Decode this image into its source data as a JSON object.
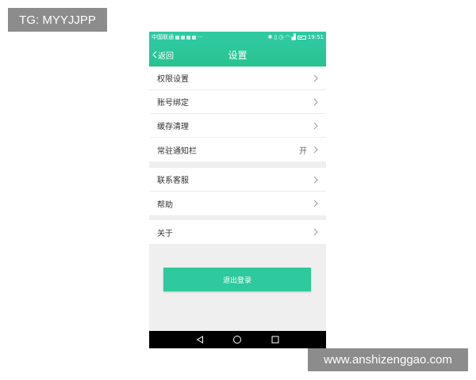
{
  "watermark_top": "TG: MYYJJPP",
  "watermark_bottom": "www.anshizenggao.com",
  "statusbar": {
    "carrier": "中国联通",
    "dots": "···",
    "time": "19:51"
  },
  "header": {
    "back_label": "返回",
    "title": "设置"
  },
  "groups": [
    {
      "items": [
        {
          "label": "权限设置"
        },
        {
          "label": "账号绑定"
        },
        {
          "label": "缓存清理"
        },
        {
          "label": "常驻通知栏",
          "value": "开"
        }
      ]
    },
    {
      "items": [
        {
          "label": "联系客服"
        },
        {
          "label": "帮助"
        }
      ]
    },
    {
      "items": [
        {
          "label": "关于"
        }
      ]
    }
  ],
  "logout_label": "退出登录",
  "colors": {
    "accent": "#2ec99c",
    "background": "#efefef",
    "navbar": "#000000"
  }
}
